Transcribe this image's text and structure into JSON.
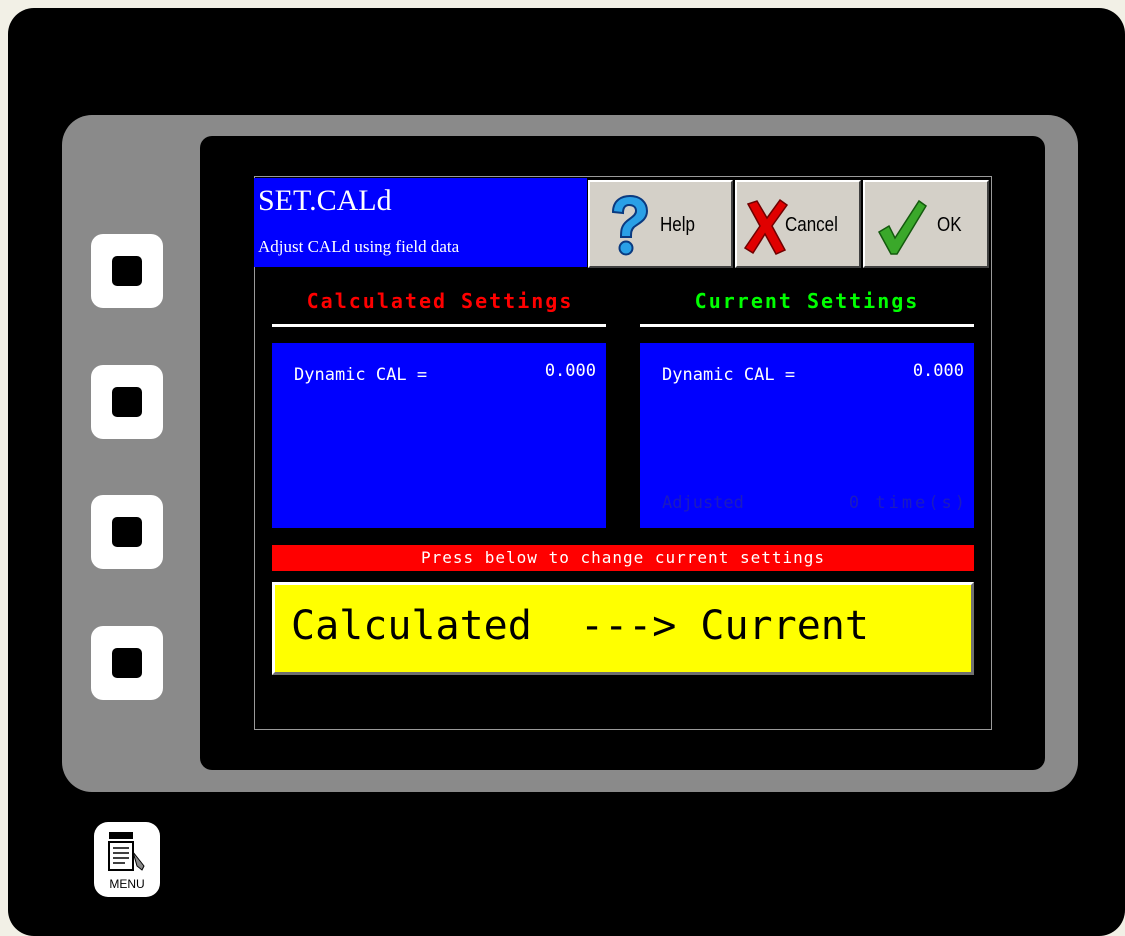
{
  "header": {
    "title": "SET.CALd",
    "subtitle": "Adjust CALd using field data"
  },
  "toolbar": {
    "help_label": "Help",
    "cancel_label": "Cancel",
    "ok_label": "OK"
  },
  "calculated": {
    "heading": "Calculated Settings",
    "heading_color": "#ff0000",
    "key": "Dynamic CAL =",
    "value": "0.000"
  },
  "current": {
    "heading": "Current Settings",
    "heading_color": "#00ff00",
    "key": "Dynamic CAL =",
    "value": "0.000",
    "adjusted_label": "Adjusted",
    "adjusted_value": "0 time(s)"
  },
  "instruction": "Press below to change current settings",
  "action_button": "Calculated  ---> Current",
  "menu_label": "MENU",
  "colors": {
    "panel_bg": "#0000ff",
    "instruction_bg": "#ff0000",
    "action_bg": "#ffff00"
  },
  "icons": {
    "help": "question-mark-icon",
    "cancel": "x-mark-icon",
    "ok": "check-mark-icon",
    "menu": "menu-document-icon"
  }
}
